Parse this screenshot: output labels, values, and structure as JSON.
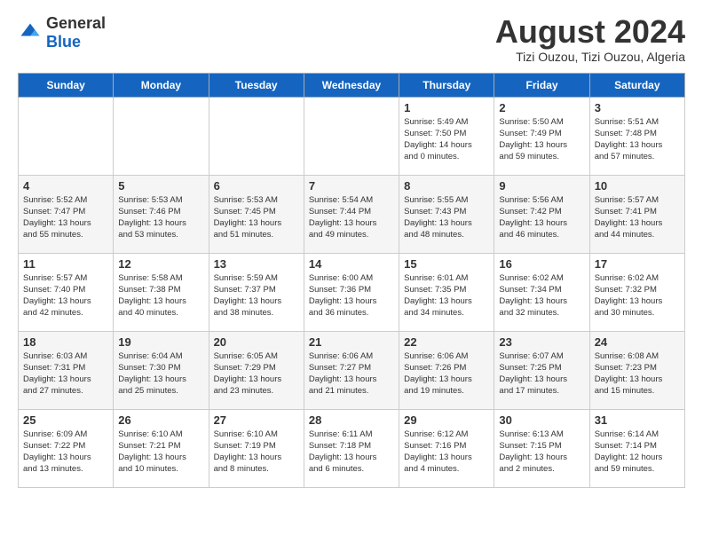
{
  "header": {
    "logo_general": "General",
    "logo_blue": "Blue",
    "month_year": "August 2024",
    "location": "Tizi Ouzou, Tizi Ouzou, Algeria"
  },
  "weekdays": [
    "Sunday",
    "Monday",
    "Tuesday",
    "Wednesday",
    "Thursday",
    "Friday",
    "Saturday"
  ],
  "weeks": [
    [
      {
        "day": "",
        "info": ""
      },
      {
        "day": "",
        "info": ""
      },
      {
        "day": "",
        "info": ""
      },
      {
        "day": "",
        "info": ""
      },
      {
        "day": "1",
        "info": "Sunrise: 5:49 AM\nSunset: 7:50 PM\nDaylight: 14 hours\nand 0 minutes."
      },
      {
        "day": "2",
        "info": "Sunrise: 5:50 AM\nSunset: 7:49 PM\nDaylight: 13 hours\nand 59 minutes."
      },
      {
        "day": "3",
        "info": "Sunrise: 5:51 AM\nSunset: 7:48 PM\nDaylight: 13 hours\nand 57 minutes."
      }
    ],
    [
      {
        "day": "4",
        "info": "Sunrise: 5:52 AM\nSunset: 7:47 PM\nDaylight: 13 hours\nand 55 minutes."
      },
      {
        "day": "5",
        "info": "Sunrise: 5:53 AM\nSunset: 7:46 PM\nDaylight: 13 hours\nand 53 minutes."
      },
      {
        "day": "6",
        "info": "Sunrise: 5:53 AM\nSunset: 7:45 PM\nDaylight: 13 hours\nand 51 minutes."
      },
      {
        "day": "7",
        "info": "Sunrise: 5:54 AM\nSunset: 7:44 PM\nDaylight: 13 hours\nand 49 minutes."
      },
      {
        "day": "8",
        "info": "Sunrise: 5:55 AM\nSunset: 7:43 PM\nDaylight: 13 hours\nand 48 minutes."
      },
      {
        "day": "9",
        "info": "Sunrise: 5:56 AM\nSunset: 7:42 PM\nDaylight: 13 hours\nand 46 minutes."
      },
      {
        "day": "10",
        "info": "Sunrise: 5:57 AM\nSunset: 7:41 PM\nDaylight: 13 hours\nand 44 minutes."
      }
    ],
    [
      {
        "day": "11",
        "info": "Sunrise: 5:57 AM\nSunset: 7:40 PM\nDaylight: 13 hours\nand 42 minutes."
      },
      {
        "day": "12",
        "info": "Sunrise: 5:58 AM\nSunset: 7:38 PM\nDaylight: 13 hours\nand 40 minutes."
      },
      {
        "day": "13",
        "info": "Sunrise: 5:59 AM\nSunset: 7:37 PM\nDaylight: 13 hours\nand 38 minutes."
      },
      {
        "day": "14",
        "info": "Sunrise: 6:00 AM\nSunset: 7:36 PM\nDaylight: 13 hours\nand 36 minutes."
      },
      {
        "day": "15",
        "info": "Sunrise: 6:01 AM\nSunset: 7:35 PM\nDaylight: 13 hours\nand 34 minutes."
      },
      {
        "day": "16",
        "info": "Sunrise: 6:02 AM\nSunset: 7:34 PM\nDaylight: 13 hours\nand 32 minutes."
      },
      {
        "day": "17",
        "info": "Sunrise: 6:02 AM\nSunset: 7:32 PM\nDaylight: 13 hours\nand 30 minutes."
      }
    ],
    [
      {
        "day": "18",
        "info": "Sunrise: 6:03 AM\nSunset: 7:31 PM\nDaylight: 13 hours\nand 27 minutes."
      },
      {
        "day": "19",
        "info": "Sunrise: 6:04 AM\nSunset: 7:30 PM\nDaylight: 13 hours\nand 25 minutes."
      },
      {
        "day": "20",
        "info": "Sunrise: 6:05 AM\nSunset: 7:29 PM\nDaylight: 13 hours\nand 23 minutes."
      },
      {
        "day": "21",
        "info": "Sunrise: 6:06 AM\nSunset: 7:27 PM\nDaylight: 13 hours\nand 21 minutes."
      },
      {
        "day": "22",
        "info": "Sunrise: 6:06 AM\nSunset: 7:26 PM\nDaylight: 13 hours\nand 19 minutes."
      },
      {
        "day": "23",
        "info": "Sunrise: 6:07 AM\nSunset: 7:25 PM\nDaylight: 13 hours\nand 17 minutes."
      },
      {
        "day": "24",
        "info": "Sunrise: 6:08 AM\nSunset: 7:23 PM\nDaylight: 13 hours\nand 15 minutes."
      }
    ],
    [
      {
        "day": "25",
        "info": "Sunrise: 6:09 AM\nSunset: 7:22 PM\nDaylight: 13 hours\nand 13 minutes."
      },
      {
        "day": "26",
        "info": "Sunrise: 6:10 AM\nSunset: 7:21 PM\nDaylight: 13 hours\nand 10 minutes."
      },
      {
        "day": "27",
        "info": "Sunrise: 6:10 AM\nSunset: 7:19 PM\nDaylight: 13 hours\nand 8 minutes."
      },
      {
        "day": "28",
        "info": "Sunrise: 6:11 AM\nSunset: 7:18 PM\nDaylight: 13 hours\nand 6 minutes."
      },
      {
        "day": "29",
        "info": "Sunrise: 6:12 AM\nSunset: 7:16 PM\nDaylight: 13 hours\nand 4 minutes."
      },
      {
        "day": "30",
        "info": "Sunrise: 6:13 AM\nSunset: 7:15 PM\nDaylight: 13 hours\nand 2 minutes."
      },
      {
        "day": "31",
        "info": "Sunrise: 6:14 AM\nSunset: 7:14 PM\nDaylight: 12 hours\nand 59 minutes."
      }
    ]
  ]
}
